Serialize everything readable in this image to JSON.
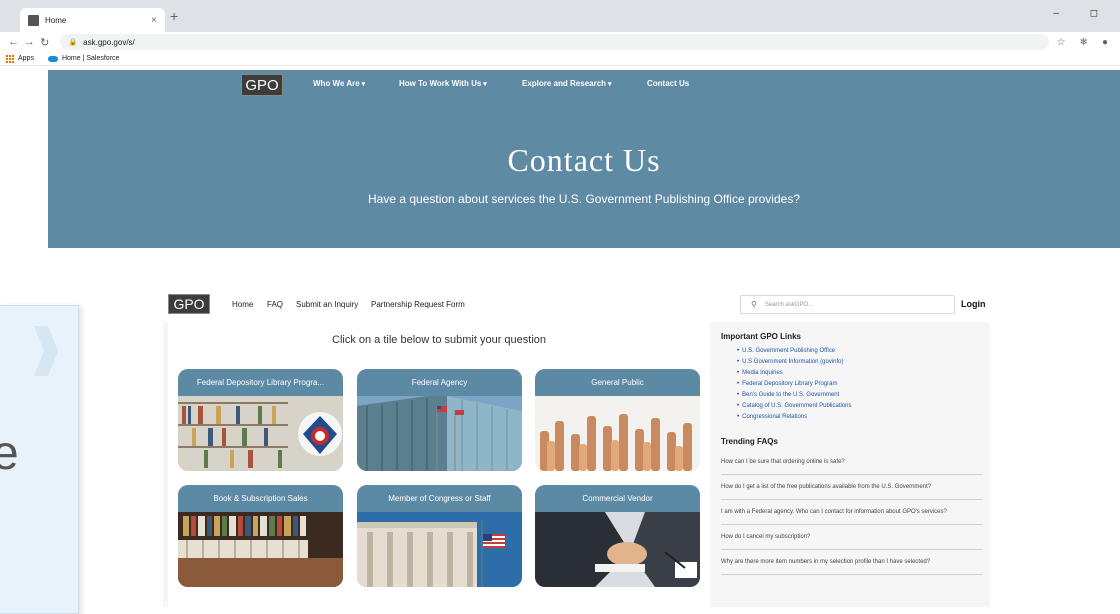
{
  "browser": {
    "tab_title": "Home",
    "tab_close": "×",
    "new_tab": "+",
    "window_controls": "–  ◻",
    "url": "ask.gpo.gov/s/",
    "bookmarks": [
      {
        "label": "Apps"
      },
      {
        "label": "Home | Salesforce"
      }
    ]
  },
  "site_nav": {
    "logo": "GPO",
    "items": [
      {
        "label": "Who We Are",
        "caret": "▾"
      },
      {
        "label": "How To Work With Us",
        "caret": "▾"
      },
      {
        "label": "Explore and Research",
        "caret": "▾"
      },
      {
        "label": "Contact Us",
        "caret": ""
      }
    ]
  },
  "hero": {
    "title": "Contact Us",
    "subtitle": "Have a question about services the U.S. Government Publishing Office provides?"
  },
  "portal_nav": {
    "logo": "GPO",
    "links": [
      {
        "label": "Home"
      },
      {
        "label": "FAQ"
      },
      {
        "label": "Submit an Inquiry"
      },
      {
        "label": "Partnership Request Form"
      }
    ],
    "search_placeholder": "Search askGPO...",
    "login": "Login"
  },
  "tiles": {
    "heading": "Click on a tile below to submit your question",
    "items": [
      {
        "label": "Federal Depository Library Progra...",
        "image": "library-shelves-image"
      },
      {
        "label": "Federal Agency",
        "image": "federal-building-image"
      },
      {
        "label": "General Public",
        "image": "raised-hands-image"
      },
      {
        "label": "Book & Subscription Sales",
        "image": "bookstore-image"
      },
      {
        "label": "Member of Congress or Staff",
        "image": "capitol-image"
      },
      {
        "label": "Commercial Vendor",
        "image": "handshake-image"
      }
    ]
  },
  "sidebar": {
    "links_title": "Important GPO Links",
    "links": [
      "U.S. Government Publishing Office",
      "U.S Government Information (govinfo)",
      "Media Inquiries",
      "Federal Depository Library Program",
      "Ben's Guide to the U.S. Government",
      "Catalog of U.S. Government Publications",
      "Congressional Relations"
    ],
    "faq_title": "Trending FAQs",
    "faqs": [
      "How can I be sure that ordering online is safe?",
      "How do I get a list of the free publications available from the U.S. Government?",
      "I am with a Federal agency. Who can I contact for information about GPO's services?",
      "How do I cancel my subscription?",
      "Why are there more item numbers in my selection profile than I have selected?"
    ]
  },
  "overlay": {
    "text": "e"
  },
  "colors": {
    "nav_blue": "#5f8aa4",
    "tile_header": "#5c8aa5",
    "link_blue": "#2155a5",
    "logo_bg": "#3c3c3c"
  }
}
